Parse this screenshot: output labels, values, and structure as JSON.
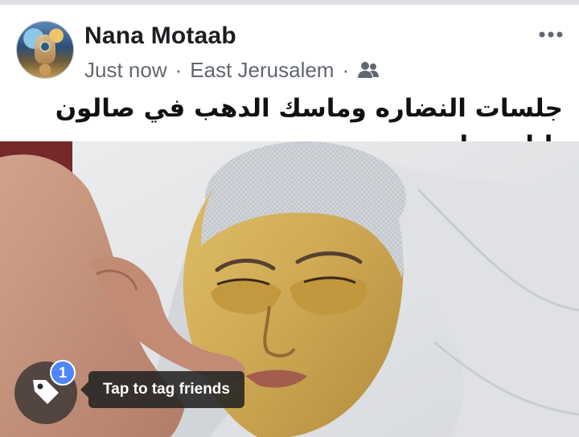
{
  "post": {
    "author": "Nana Motaab",
    "time": "Just now",
    "separator": "·",
    "location": "East Jerusalem",
    "audience_icon": "friends-icon",
    "more_icon": "more-icon",
    "text": "جلسات النضاره وماسك الدهب في صالون نانا ودينا"
  },
  "photo": {
    "tag_count": "1",
    "tag_tooltip": "Tap to tag friends",
    "tag_icon": "tag-icon"
  },
  "colors": {
    "name": "#1c1e21",
    "meta": "#616770",
    "badge": "#4f86f7"
  }
}
